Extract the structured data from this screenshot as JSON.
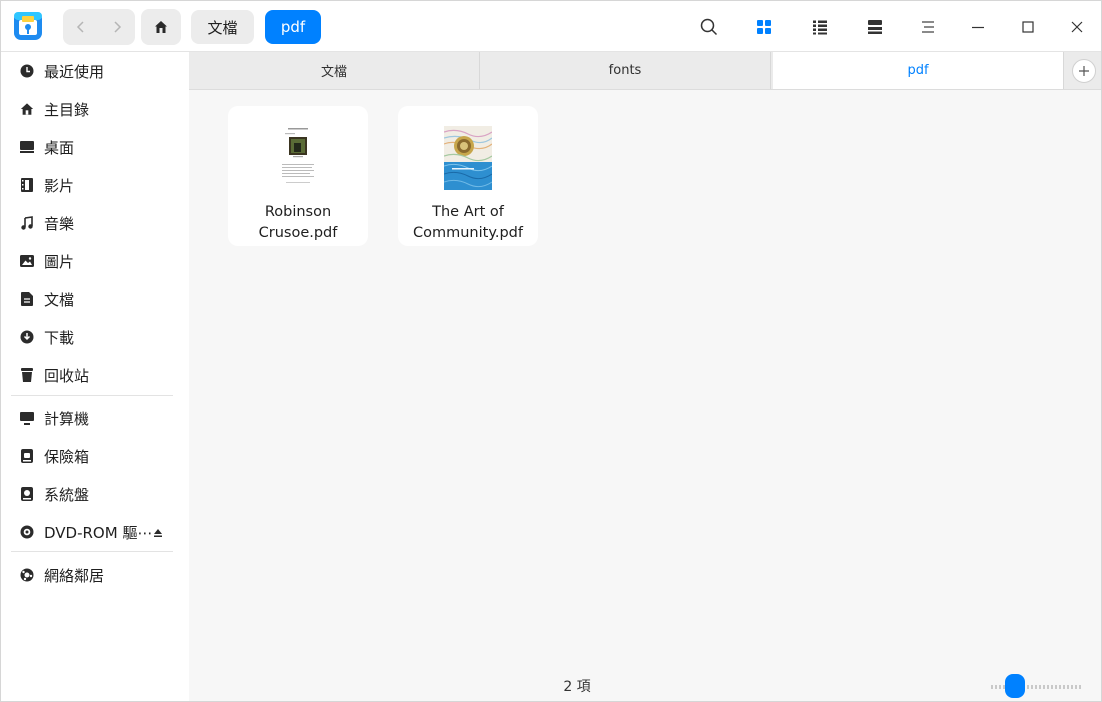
{
  "toolbar": {
    "back_icon": "chevron-left-icon",
    "forward_icon": "chevron-right-icon",
    "home_icon": "home-icon",
    "breadcrumbs": [
      "文檔",
      "pdf"
    ],
    "search_icon": "search-icon",
    "icon_view_icon": "grid-icon",
    "list_view_icon": "list-icon",
    "tree_view_icon": "tree-icon",
    "menu_icon": "menu-icon",
    "minimize_icon": "minimize-icon",
    "maximize_icon": "maximize-icon",
    "close_icon": "close-icon"
  },
  "sidebar": {
    "items": [
      {
        "label": "最近使用",
        "icon": "clock-icon"
      },
      {
        "label": "主目錄",
        "icon": "home-icon"
      },
      {
        "label": "桌面",
        "icon": "desktop-icon"
      },
      {
        "label": "影片",
        "icon": "film-icon"
      },
      {
        "label": "音樂",
        "icon": "music-icon"
      },
      {
        "label": "圖片",
        "icon": "picture-icon"
      },
      {
        "label": "文檔",
        "icon": "document-icon"
      },
      {
        "label": "下載",
        "icon": "download-icon"
      },
      {
        "label": "回收站",
        "icon": "trash-icon"
      },
      {
        "label": "計算機",
        "icon": "computer-icon"
      },
      {
        "label": "保險箱",
        "icon": "vault-icon"
      },
      {
        "label": "系統盤",
        "icon": "disk-icon"
      },
      {
        "label": "DVD-ROM 驅⋯",
        "icon": "disc-icon"
      },
      {
        "label": "網絡鄰居",
        "icon": "network-icon"
      }
    ]
  },
  "tabs": [
    {
      "label": "文檔",
      "active": false
    },
    {
      "label": "fonts",
      "active": false
    },
    {
      "label": "pdf",
      "active": true
    }
  ],
  "files": [
    {
      "line1": "Robinson",
      "line2": "Crusoe.pdf"
    },
    {
      "line1": "The Art of",
      "line2": "Community.pdf"
    }
  ],
  "status": {
    "count": "2 項"
  },
  "colors": {
    "accent": "#0081ff",
    "sidebar_bg": "#ffffff",
    "content_bg": "#f7f7f7"
  }
}
